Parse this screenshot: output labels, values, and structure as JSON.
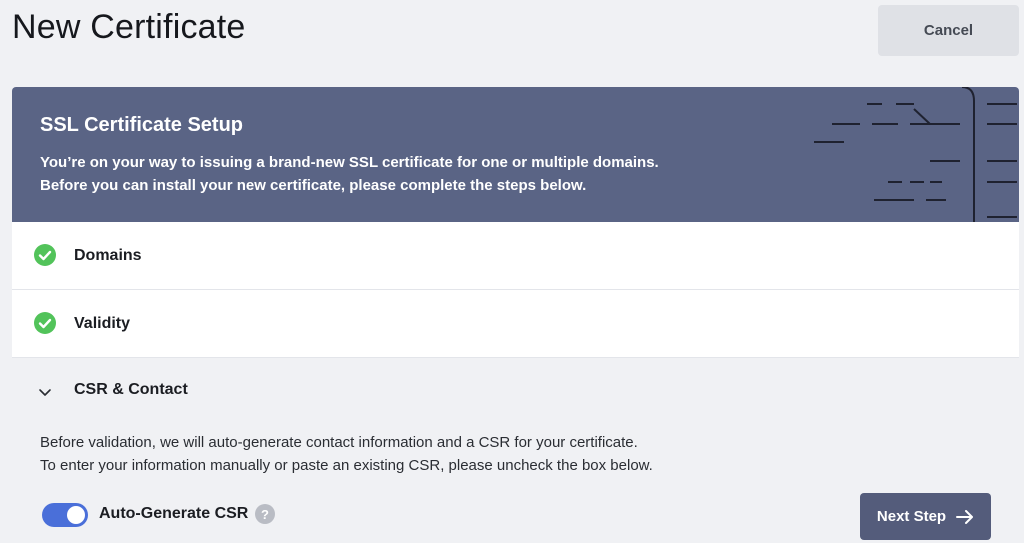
{
  "page": {
    "title": "New Certificate",
    "cancel_label": "Cancel"
  },
  "setup": {
    "title": "SSL Certificate Setup",
    "description_line1": "You’re on your way to issuing a brand-new SSL certificate for one or multiple domains.",
    "description_line2": "Before you can install your new certificate, please complete the steps below."
  },
  "steps": [
    {
      "label": "Domains",
      "status": "complete",
      "icon": "check-circle-icon"
    },
    {
      "label": "Validity",
      "status": "complete",
      "icon": "check-circle-icon"
    },
    {
      "label": "CSR & Contact",
      "status": "open",
      "icon": "chevron-down-icon"
    }
  ],
  "csr": {
    "info_line1": "Before validation, we will auto-generate contact information and a CSR for your certificate.",
    "info_line2": "To enter your information manually or paste an existing CSR, please uncheck the box below.",
    "toggle_label": "Auto-Generate CSR",
    "toggle_on": true,
    "help_symbol": "?",
    "next_label": "Next Step"
  },
  "colors": {
    "header_bg": "#5a6485",
    "check_green": "#52c35a",
    "toggle_blue": "#4a6fd9",
    "next_button_bg": "#545c7b"
  }
}
